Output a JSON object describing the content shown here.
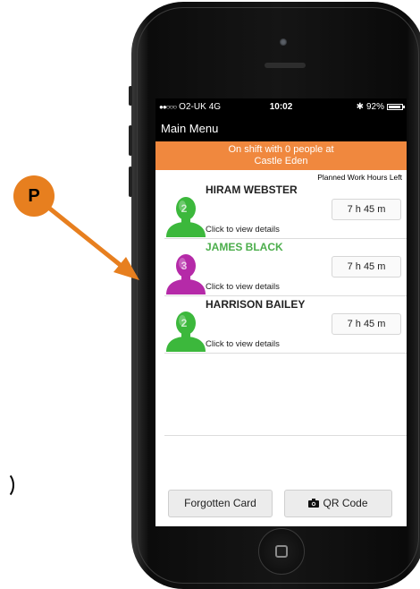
{
  "callout": {
    "label": "P"
  },
  "status_bar": {
    "carrier": "O2-UK",
    "network": "4G",
    "time": "10:02",
    "bluetooth_icon": "bluetooth-icon",
    "battery": "92%"
  },
  "header": {
    "title": "Main Menu"
  },
  "banner": {
    "line1": "On shift with 0 people at",
    "line2": "Castle Eden"
  },
  "list": {
    "column_header": "Planned Work Hours Left",
    "rows": [
      {
        "name": "HIRAM WEBSTER",
        "badge": "2",
        "avatar_color": "#3cb83c",
        "details": "Click to view details",
        "hours": "7 h 45 m"
      },
      {
        "name": "JAMES BLACK",
        "badge": "3",
        "avatar_color": "#b52aa8",
        "details": "Click to view details",
        "hours": "7 h 45 m"
      },
      {
        "name": "HARRISON BAILEY",
        "badge": "2",
        "avatar_color": "#3cb83c",
        "details": "Click to view details",
        "hours": "7 h 45 m"
      }
    ]
  },
  "footer": {
    "forgotten_label": "Forgotten Card",
    "qr_label": "QR Code",
    "qr_icon": "camera-icon"
  },
  "colors": {
    "accent": "#f0883e",
    "highlight_name": "#4cae4c",
    "callout": "#e77f1f"
  }
}
